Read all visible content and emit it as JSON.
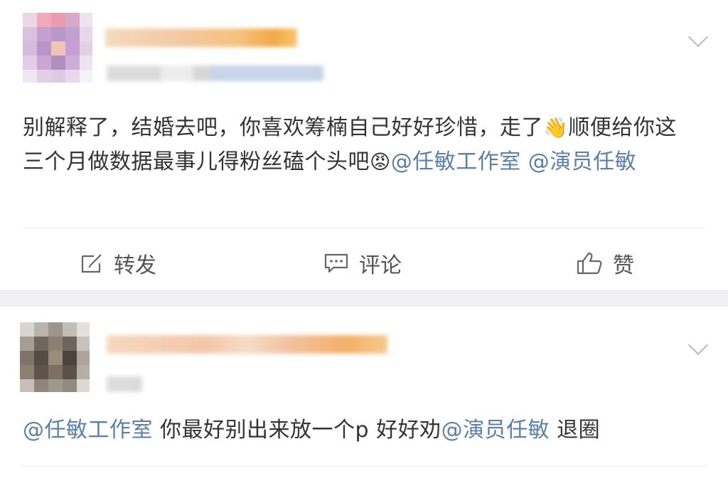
{
  "posts": [
    {
      "text_parts": [
        {
          "type": "text",
          "value": "别解释了，结婚去吧，你喜欢筹楠自己好好珍惜，走了"
        },
        {
          "type": "emoji",
          "value": "👋"
        },
        {
          "type": "text",
          "value": "顺便给你这三个月做数据最事儿得粉丝磕个头吧"
        },
        {
          "type": "emoji",
          "value": "😡"
        },
        {
          "type": "mention",
          "value": "@任敏工作室"
        },
        {
          "type": "text",
          "value": " "
        },
        {
          "type": "mention",
          "value": "@演员任敏"
        }
      ],
      "actions": {
        "repost_label": "转发",
        "comment_label": "评论",
        "like_label": "赞"
      }
    },
    {
      "text_parts": [
        {
          "type": "mention",
          "value": "@任敏工作室"
        },
        {
          "type": "text",
          "value": " 你最好别出来放一个p 好好劝"
        },
        {
          "type": "mention",
          "value": "@演员任敏"
        },
        {
          "type": "text",
          "value": " 退圈"
        }
      ]
    }
  ],
  "icons": {
    "more": "chevron-down-icon",
    "repost": "edit-icon",
    "comment": "comment-icon",
    "like": "thumbs-up-icon"
  },
  "colors": {
    "mention": "#5b7fa8",
    "text": "#333333",
    "separator": "#eef0f2"
  }
}
